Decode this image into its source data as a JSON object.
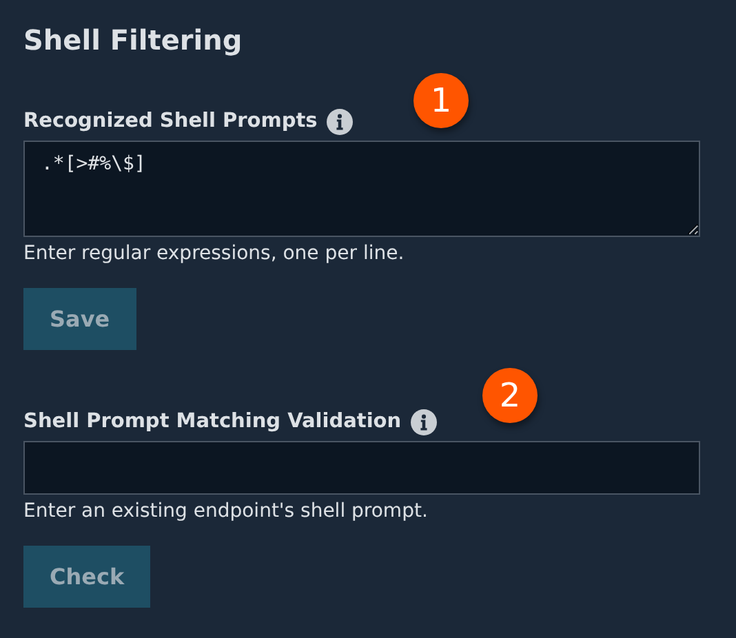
{
  "title": "Shell Filtering",
  "sections": [
    {
      "label": "Recognized Shell Prompts",
      "badge": "1",
      "kind": "textarea",
      "value": ".*[>#%\\$]",
      "help": "Enter regular expressions, one per line.",
      "button": {
        "label": "Save",
        "disabled": true
      }
    },
    {
      "label": "Shell Prompt Matching Validation",
      "badge": "2",
      "kind": "input",
      "help": "Enter an existing endpoint's shell prompt.",
      "button": {
        "label": "Check",
        "disabled": true
      }
    }
  ]
}
